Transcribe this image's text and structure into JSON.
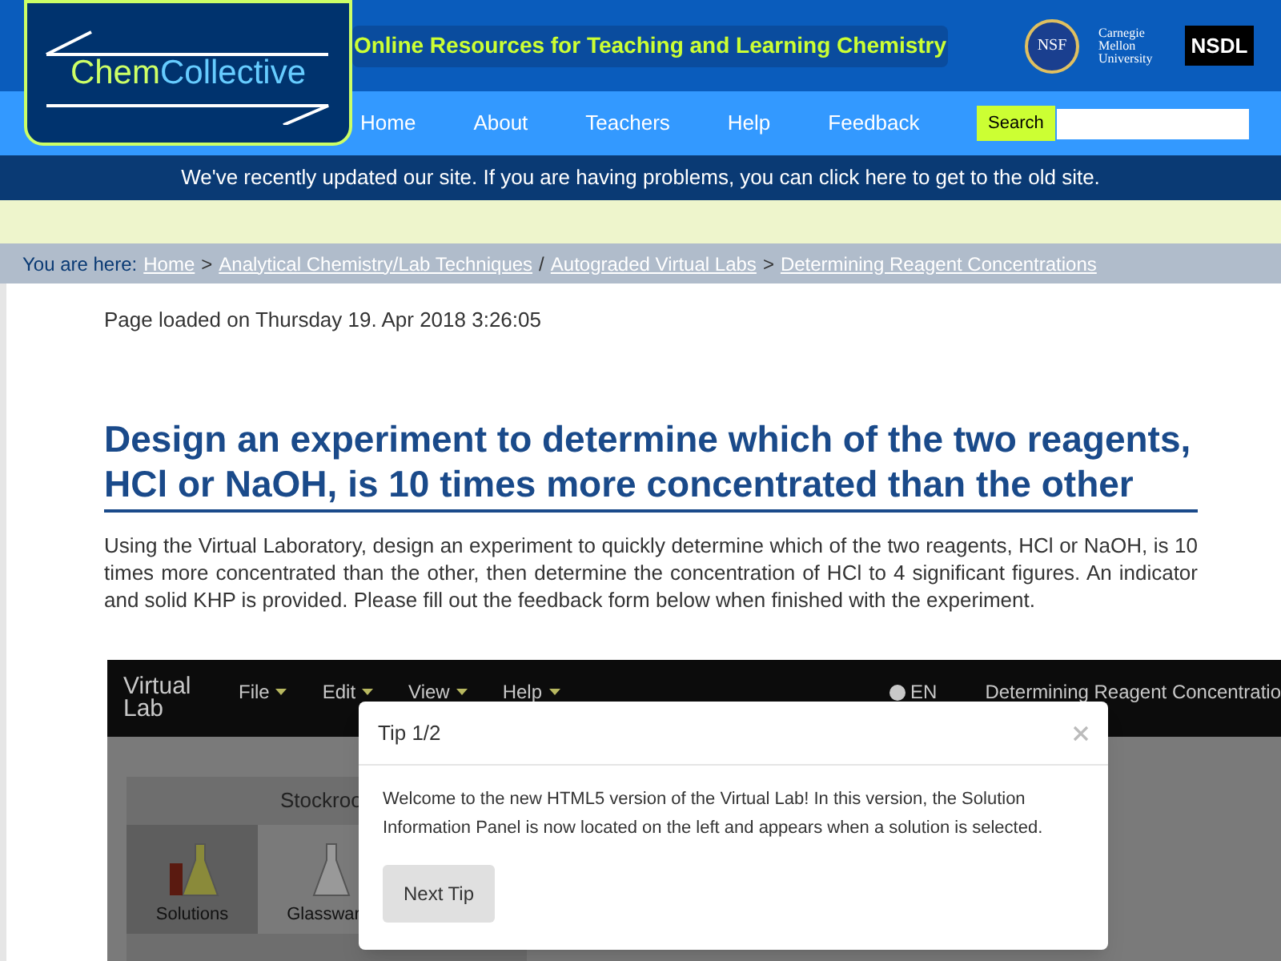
{
  "header": {
    "logo": {
      "part_1": "Chem",
      "part_2": "Coll",
      "part_3": "ective"
    },
    "tagline": "Online Resources for Teaching and Learning Chemistry",
    "partners": {
      "nsf": "NSF",
      "cmu": [
        "Carnegie",
        "Mellon",
        "University"
      ],
      "nsdl": "NSDL"
    }
  },
  "nav": {
    "items": [
      {
        "label": "Home"
      },
      {
        "label": "About"
      },
      {
        "label": "Teachers"
      },
      {
        "label": "Help"
      },
      {
        "label": "Feedback"
      }
    ],
    "search_button": "Search"
  },
  "notice": "We've recently updated our site. If you are having problems, you can click here to get to the old site.",
  "breadcrumb": {
    "label": "You are here:",
    "links": [
      {
        "label": "Home",
        "sep": ">"
      },
      {
        "label": "Analytical Chemistry/Lab Techniques",
        "sep": "/"
      },
      {
        "label": "Autograded Virtual Labs",
        "sep": ">"
      },
      {
        "label": "Determining Reagent Concentrations"
      }
    ]
  },
  "page_loaded": "Page loaded on Thursday 19. Apr 2018 3:26:05",
  "heading": "Design an experiment to determine which of the two reagents, HCl or NaOH, is 10 times more concentrated than the other",
  "intro": "Using the Virtual Laboratory, design an experiment to quickly determine which of the two reagents, HCl or NaOH, is 10 times more concentrated than the other, then determine the concentration of HCl to 4 significant figures. An indicator and solid KHP is provided. Please fill out the feedback form below when finished with the experiment.",
  "virtual_lab": {
    "brand": [
      "Virtual",
      "Lab"
    ],
    "menus": [
      {
        "label": "File"
      },
      {
        "label": "Edit"
      },
      {
        "label": "View"
      },
      {
        "label": "Help"
      }
    ],
    "language": "EN",
    "lab_title": "Determining Reagent Concentratio",
    "stockroom_tab": "Stockroo",
    "categories": [
      {
        "label": "Solutions",
        "selected": true
      },
      {
        "label": "Glasswar",
        "selected": false
      }
    ],
    "dialog": {
      "title": "Tip 1/2",
      "body": "Welcome to the new HTML5 version of the Virtual Lab! In this version, the Solution Information Panel is now located on the left and appears when a solution is selected.",
      "button": "Next Tip"
    }
  }
}
